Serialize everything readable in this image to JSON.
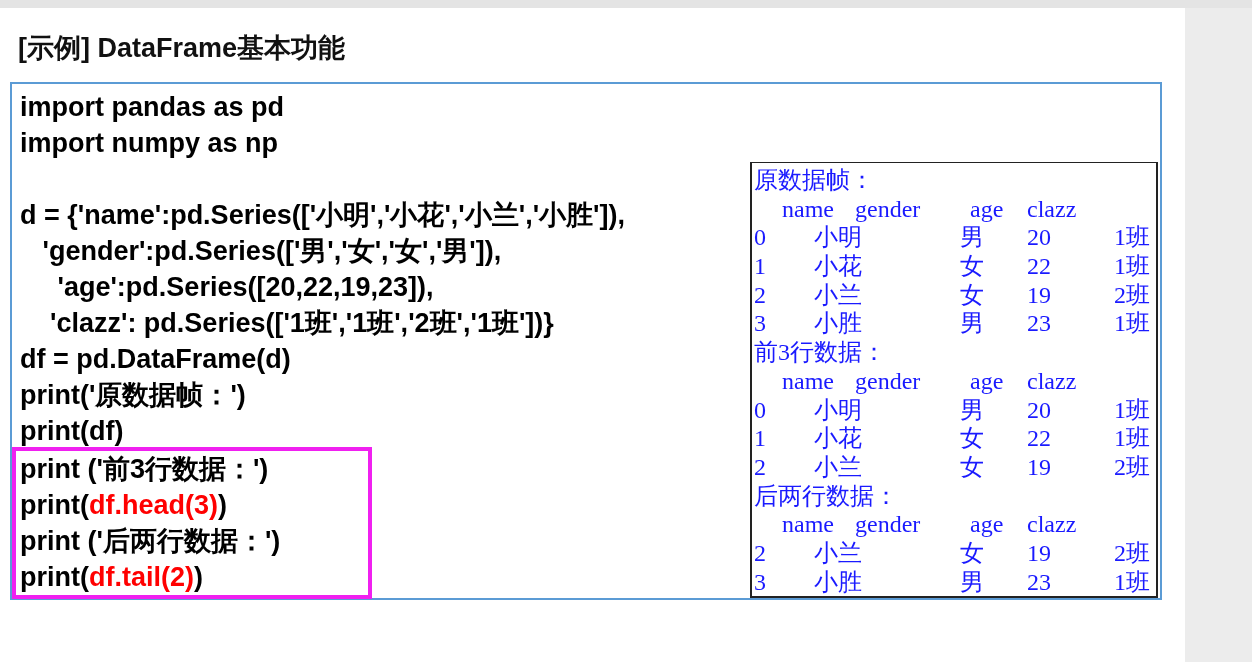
{
  "slide": {
    "title": "[示例] DataFrame基本功能",
    "code_blocks": [
      {
        "boxed": false,
        "lines": [
          {
            "blank_line_before": false,
            "parts": [
              {
                "text": "import pandas as pd",
                "highlighted": false
              }
            ]
          },
          {
            "blank_line_before": false,
            "parts": [
              {
                "text": "import numpy as np",
                "highlighted": false
              }
            ]
          },
          {
            "blank_line_before": true,
            "parts": [
              {
                "text": "d = {'name':pd.Series(['小明','小花','小兰','小胜']),",
                "highlighted": false
              }
            ]
          },
          {
            "blank_line_before": false,
            "parts": [
              {
                "text": "   'gender':pd.Series(['男','女','女','男']),",
                "highlighted": false
              }
            ]
          },
          {
            "blank_line_before": false,
            "parts": [
              {
                "text": "     'age':pd.Series([20,22,19,23]),",
                "highlighted": false
              }
            ]
          },
          {
            "blank_line_before": false,
            "parts": [
              {
                "text": "    'clazz': pd.Series(['1班','1班','2班','1班'])}",
                "highlighted": false
              }
            ]
          },
          {
            "blank_line_before": false,
            "parts": [
              {
                "text": "df = pd.DataFrame(d)",
                "highlighted": false
              }
            ]
          },
          {
            "blank_line_before": false,
            "parts": [
              {
                "text": "print('原数据帧：')",
                "highlighted": false
              }
            ]
          },
          {
            "blank_line_before": false,
            "parts": [
              {
                "text": "print(df)",
                "highlighted": false
              }
            ]
          }
        ]
      },
      {
        "boxed": true,
        "lines": [
          {
            "blank_line_before": false,
            "parts": [
              {
                "text": "print ('前3行数据：')",
                "highlighted": false
              }
            ]
          },
          {
            "blank_line_before": false,
            "parts": [
              {
                "text": "print(",
                "highlighted": false
              },
              {
                "text": "df.head(3)",
                "highlighted": true
              },
              {
                "text": ")",
                "highlighted": false
              }
            ]
          },
          {
            "blank_line_before": false,
            "parts": [
              {
                "text": "print ('后两行数据：')",
                "highlighted": false
              }
            ]
          },
          {
            "blank_line_before": false,
            "parts": [
              {
                "text": "print(",
                "highlighted": false
              },
              {
                "text": "df.tail(2)",
                "highlighted": true
              },
              {
                "text": ")",
                "highlighted": false
              }
            ]
          }
        ]
      }
    ],
    "output": [
      {
        "heading": "原数据帧：",
        "columns": [
          "name",
          "gender",
          "age",
          "clazz"
        ],
        "rows": [
          [
            "0",
            "小明",
            "男",
            "20",
            "1班"
          ],
          [
            "1",
            "小花",
            "女",
            "22",
            "1班"
          ],
          [
            "2",
            "小兰",
            "女",
            "19",
            "2班"
          ],
          [
            "3",
            "小胜",
            "男",
            "23",
            "1班"
          ]
        ]
      },
      {
        "heading": "前3行数据：",
        "columns": [
          "name",
          "gender",
          "age",
          "clazz"
        ],
        "rows": [
          [
            "0",
            "小明",
            "男",
            "20",
            "1班"
          ],
          [
            "1",
            "小花",
            "女",
            "22",
            "1班"
          ],
          [
            "2",
            "小兰",
            "女",
            "19",
            "2班"
          ]
        ]
      },
      {
        "heading": "后两行数据：",
        "columns": [
          "name",
          "gender",
          "age",
          "clazz"
        ],
        "rows": [
          [
            "2",
            "小兰",
            "女",
            "19",
            "2班"
          ],
          [
            "3",
            "小胜",
            "男",
            "23",
            "1班"
          ]
        ]
      }
    ]
  }
}
